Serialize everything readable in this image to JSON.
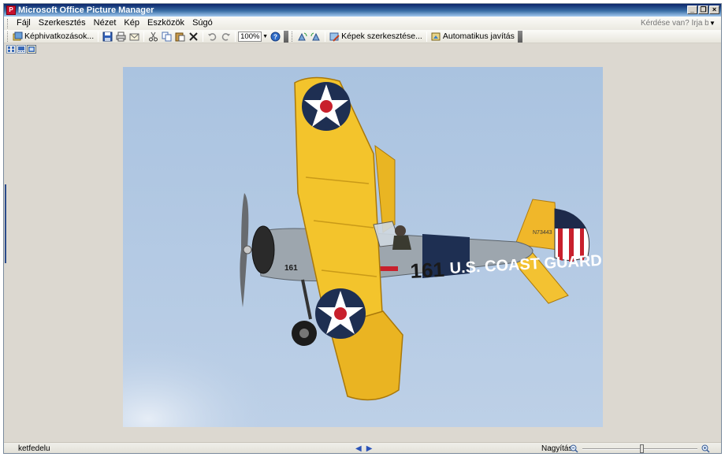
{
  "window": {
    "title": "Microsoft Office Picture Manager",
    "controls": {
      "minimize": "_",
      "restore": "❒",
      "close": "×"
    }
  },
  "menu": {
    "items": [
      "Fájl",
      "Szerkesztés",
      "Nézet",
      "Kép",
      "Eszközök",
      "Súgó"
    ],
    "help_placeholder": "Kérdése van? Írja be ide."
  },
  "toolbar": {
    "shortcuts_label": "Képhivatkozások...",
    "zoom_value": "100%",
    "edit_pictures_label": "Képek szerkesztése...",
    "auto_correct_label": "Automatikus javítás"
  },
  "statusbar": {
    "file_name": "ketfedelu",
    "zoom_label": "Nagyítás:",
    "zoom_level": 0.52
  },
  "image": {
    "subject": "yellow biplane",
    "markings": [
      "161",
      "U.S. COAST GUARD",
      "N73443"
    ],
    "sky_color": "#b4c9e2"
  },
  "icons": [
    "shortcuts-icon",
    "save-icon",
    "print-icon",
    "email-icon",
    "cut-icon",
    "copy-icon",
    "paste-icon",
    "delete-icon",
    "undo-icon",
    "redo-icon",
    "help-icon",
    "rotate-left-icon",
    "rotate-right-icon",
    "edit-pictures-icon",
    "auto-correct-icon",
    "thumbnail-view-icon",
    "filmstrip-view-icon",
    "single-view-icon",
    "zoom-out-icon",
    "zoom-in-icon"
  ]
}
